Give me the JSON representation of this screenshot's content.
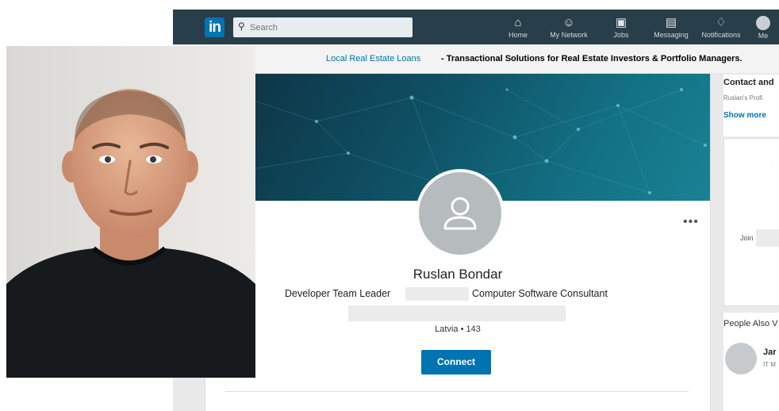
{
  "colors": {
    "nav_bg": "#283e4a",
    "brand_blue": "#0073b1",
    "banner_dark": "#0d2f3f",
    "banner_light": "#1a8194",
    "shirt": "#161a1c"
  },
  "topnav": {
    "logo": "in",
    "search": {
      "placeholder": "Search",
      "icon": "search-icon"
    },
    "items": [
      {
        "label": "Home",
        "icon": "home-icon"
      },
      {
        "label": "My Network",
        "icon": "network-icon"
      },
      {
        "label": "Jobs",
        "icon": "briefcase-icon"
      },
      {
        "label": "Messaging",
        "icon": "messaging-icon"
      },
      {
        "label": "Notifications",
        "icon": "bell-icon"
      },
      {
        "label": "Me",
        "icon": "avatar-icon"
      }
    ]
  },
  "ad_bar": {
    "link": "Local Real Estate Loans",
    "text": "- Transactional Solutions for Real Estate Investors & Portfolio Managers."
  },
  "profile": {
    "name": "Ruslan Bondar",
    "headline_left": "Developer Team Leader",
    "headline_right": "Computer Software Consultant",
    "location": "Latvia • 143",
    "connect_label": "Connect",
    "more": "•••"
  },
  "rail": {
    "contact_title": "Contact and",
    "contact_sub": "Ruslan's Profi",
    "show_more": "Show more",
    "ad_join": "Join",
    "people_title": "People Also V",
    "person_name": "Jar",
    "person_sub": "IT M"
  }
}
